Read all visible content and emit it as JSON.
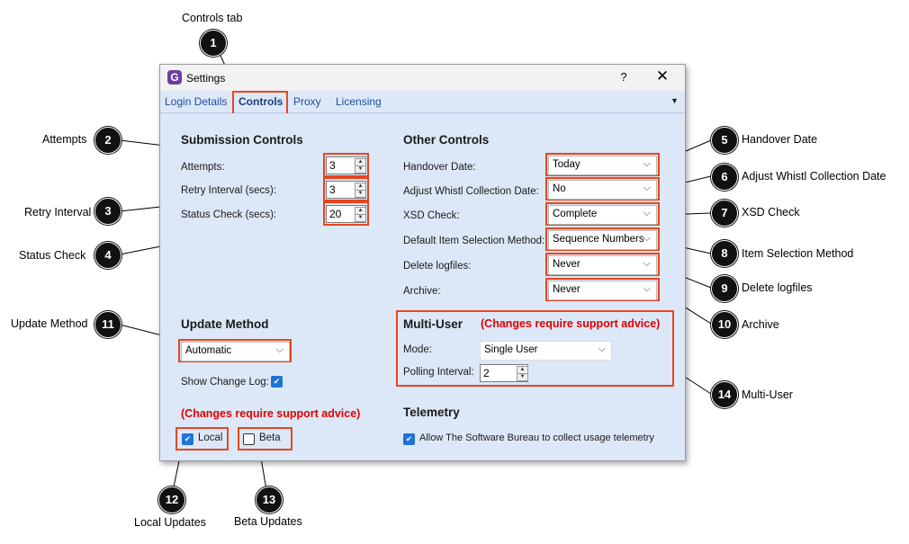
{
  "window": {
    "title": "Settings",
    "logo": "G",
    "help": "?",
    "close": "✕",
    "tab_menu": "▼"
  },
  "tabs": [
    "Login Details",
    "Controls",
    "Proxy",
    "Licensing"
  ],
  "submission": {
    "title": "Submission Controls",
    "attempts_label": "Attempts:",
    "attempts_value": "3",
    "retry_label": "Retry Interval (secs):",
    "retry_value": "3",
    "status_label": "Status Check (secs):",
    "status_value": "20"
  },
  "other": {
    "title": "Other Controls",
    "handover_label": "Handover Date:",
    "handover_value": "Today",
    "whistl_label": "Adjust Whistl Collection Date:",
    "whistl_value": "No",
    "xsd_label": "XSD Check:",
    "xsd_value": "Complete",
    "itemsel_label": "Default Item Selection Method:",
    "itemsel_value": "Sequence Numbers",
    "logfiles_label": "Delete logfiles:",
    "logfiles_value": "Never",
    "archive_label": "Archive:",
    "archive_value": "Never"
  },
  "update": {
    "title": "Update Method",
    "method_value": "Automatic",
    "changelog_label": "Show Change Log:",
    "note": "(Changes require support advice)",
    "local_label": "Local",
    "beta_label": "Beta"
  },
  "multiuser": {
    "title": "Multi-User",
    "note": "(Changes require support advice)",
    "mode_label": "Mode:",
    "mode_value": "Single User",
    "polling_label": "Polling Interval:",
    "polling_value": "2"
  },
  "telemetry": {
    "title": "Telemetry",
    "allow_label": "Allow The Software Bureau to collect usage telemetry"
  },
  "callouts": [
    {
      "num": "1",
      "label": "Controls tab"
    },
    {
      "num": "2",
      "label": "Attempts"
    },
    {
      "num": "3",
      "label": "Retry Interval"
    },
    {
      "num": "4",
      "label": "Status Check"
    },
    {
      "num": "5",
      "label": "Handover Date"
    },
    {
      "num": "6",
      "label": "Adjust Whistl Collection Date"
    },
    {
      "num": "7",
      "label": "XSD Check"
    },
    {
      "num": "8",
      "label": "Item Selection Method"
    },
    {
      "num": "9",
      "label": "Delete logfiles"
    },
    {
      "num": "10",
      "label": "Archive"
    },
    {
      "num": "11",
      "label": "Update Method"
    },
    {
      "num": "12",
      "label": "Local Updates"
    },
    {
      "num": "13",
      "label": "Beta Updates"
    },
    {
      "num": "14",
      "label": "Multi-User"
    }
  ],
  "icons": {
    "dropdown": "chevron-down-icon",
    "check": "checkmark-icon",
    "logo": "app-logo-icon"
  }
}
